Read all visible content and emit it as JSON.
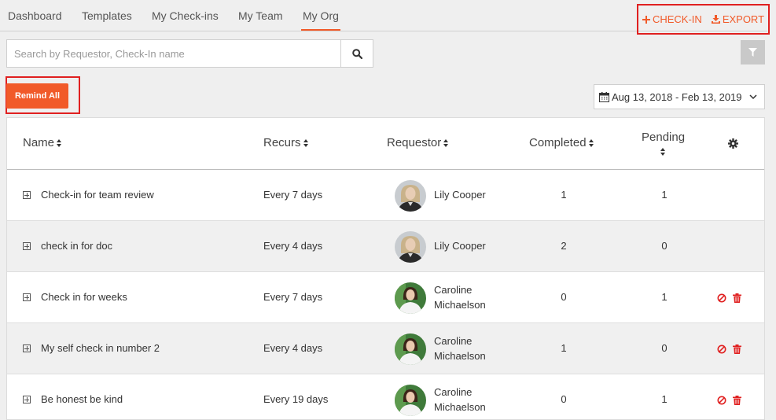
{
  "nav": {
    "tabs": [
      {
        "label": "Dashboard"
      },
      {
        "label": "Templates"
      },
      {
        "label": "My Check-ins"
      },
      {
        "label": "My Team"
      },
      {
        "label": "My Org",
        "active": true
      }
    ]
  },
  "actions": {
    "checkin_label": "CHECK-IN",
    "export_label": "EXPORT"
  },
  "search": {
    "placeholder": "Search by Requestor, Check-In name",
    "value": ""
  },
  "remind_all_label": "Remind All",
  "date_range": "Aug 13, 2018 - Feb 13, 2019",
  "table": {
    "headers": {
      "name": "Name",
      "recurs": "Recurs",
      "requestor": "Requestor",
      "completed": "Completed",
      "pending": "Pending"
    },
    "rows": [
      {
        "name": "Check-in for team review",
        "recurs": "Every 7 days",
        "requestor_line1": "Lily Cooper",
        "requestor_line2": "",
        "avatar": "lily",
        "completed": "1",
        "pending": "1",
        "actions": false
      },
      {
        "name": "check in for doc",
        "recurs": "Every 4 days",
        "requestor_line1": "Lily Cooper",
        "requestor_line2": "",
        "avatar": "lily",
        "completed": "2",
        "pending": "0",
        "actions": false
      },
      {
        "name": "Check in for weeks",
        "recurs": "Every 7 days",
        "requestor_line1": "Caroline",
        "requestor_line2": "Michaelson",
        "avatar": "caroline",
        "completed": "0",
        "pending": "1",
        "actions": true
      },
      {
        "name": "My self check in number 2",
        "recurs": "Every 4 days",
        "requestor_line1": "Caroline",
        "requestor_line2": "Michaelson",
        "avatar": "caroline",
        "completed": "1",
        "pending": "0",
        "actions": true
      },
      {
        "name": "Be honest be kind",
        "recurs": "Every 19 days",
        "requestor_line1": "Caroline",
        "requestor_line2": "Michaelson",
        "avatar": "caroline",
        "completed": "0",
        "pending": "1",
        "actions": true
      }
    ]
  },
  "colors": {
    "accent": "#f15a29",
    "highlight_border": "#e02020",
    "delete_red": "#e02020"
  },
  "icons": [
    "search-icon",
    "filter-icon",
    "calendar-icon",
    "chevron-down-icon",
    "plus-icon",
    "download-icon",
    "gear-icon",
    "expand-icon",
    "ban-icon",
    "trash-icon"
  ]
}
